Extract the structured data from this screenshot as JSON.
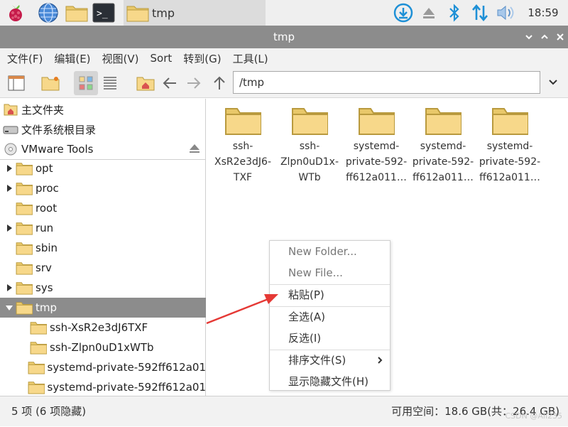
{
  "taskbar": {
    "window_label": "tmp",
    "clock": "18:59",
    "icons": [
      "raspberry-menu-icon",
      "browser-globe-icon",
      "file-manager-icon",
      "terminal-icon"
    ],
    "tray_icons": [
      "download-icon",
      "eject-icon",
      "bluetooth-icon",
      "network-transfer-icon",
      "volume-icon"
    ]
  },
  "window": {
    "title": "tmp"
  },
  "menubar": {
    "items": [
      "文件(F)",
      "编辑(E)",
      "视图(V)",
      "Sort",
      "转到(G)",
      "工具(L)"
    ]
  },
  "toolbar": {
    "path": "/tmp",
    "icons": [
      "side-pane-icon",
      "new-folder-icon",
      "icon-view-icon",
      "list-view-icon",
      "home-icon",
      "back-arrow-icon",
      "forward-arrow-icon",
      "up-arrow-icon"
    ]
  },
  "places": [
    {
      "label": "主文件夹",
      "icon": "home-icon"
    },
    {
      "label": "文件系统根目录",
      "icon": "drive-icon"
    },
    {
      "label": "VMware Tools",
      "icon": "disc-icon"
    }
  ],
  "tree": [
    {
      "label": "opt",
      "expandable": true,
      "level": 1
    },
    {
      "label": "proc",
      "expandable": true,
      "level": 1
    },
    {
      "label": "root",
      "expandable": false,
      "level": 1
    },
    {
      "label": "run",
      "expandable": true,
      "level": 1
    },
    {
      "label": "sbin",
      "expandable": false,
      "level": 1
    },
    {
      "label": "srv",
      "expandable": false,
      "level": 1
    },
    {
      "label": "sys",
      "expandable": true,
      "level": 1
    },
    {
      "label": "tmp",
      "expandable": true,
      "expanded": true,
      "selected": true,
      "level": 1
    },
    {
      "label": "ssh-XsR2e3dJ6TXF",
      "expandable": false,
      "level": 2
    },
    {
      "label": "ssh-Zlpn0uD1xWTb",
      "expandable": false,
      "level": 2
    },
    {
      "label": "systemd-private-592ff612a01",
      "expandable": false,
      "level": 2
    },
    {
      "label": "systemd-private-592ff612a01",
      "expandable": false,
      "level": 2
    }
  ],
  "files": [
    {
      "lines": [
        "ssh-",
        "XsR2e3dJ6-",
        "TXF"
      ]
    },
    {
      "lines": [
        "ssh-",
        "Zlpn0uD1x-",
        "WTb"
      ]
    },
    {
      "lines": [
        "systemd-",
        "private-592-",
        "ff612a011…"
      ]
    },
    {
      "lines": [
        "systemd-",
        "private-592-",
        "ff612a011…"
      ]
    },
    {
      "lines": [
        "systemd-",
        "private-592-",
        "ff612a011…"
      ]
    }
  ],
  "context_menu": {
    "new_folder": "New Folder...",
    "new_file": "New File...",
    "paste": "粘贴(P)",
    "select_all": "全选(A)",
    "invert_selection": "反选(I)",
    "sort_files": "排序文件(S)",
    "show_hidden": "显示隐藏文件(H)"
  },
  "status": {
    "left": "5 项 (6 项隐藏)",
    "right": "可用空间：18.6 GB(共：26.4 GB)"
  },
  "watermark": "CSDN @Ali235",
  "colors": {
    "titlebar": "#8c8c8c",
    "selection": "#8c8c8c",
    "folder": "#f7d88a",
    "annotation_arrow": "#e53935",
    "tray_accent": "#1e90d6"
  }
}
